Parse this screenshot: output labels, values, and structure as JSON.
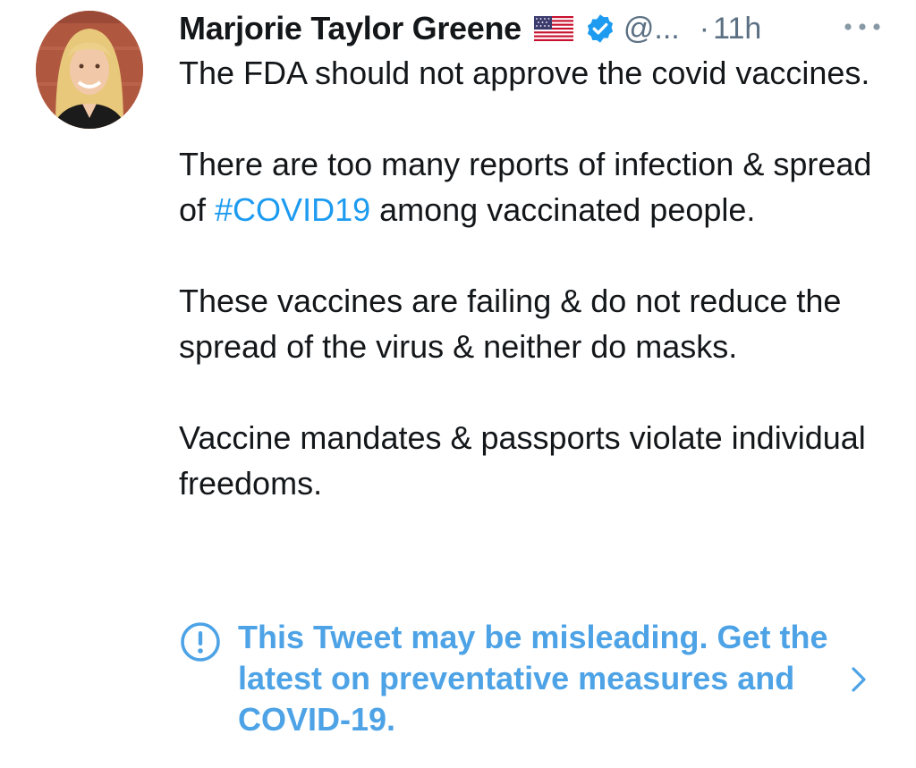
{
  "tweet": {
    "author_name": "Marjorie Taylor Greene",
    "flag": "us-flag-emoji",
    "verified": true,
    "handle": "@...",
    "separator": "·",
    "time": "11h",
    "paragraphs": [
      {
        "text": "The FDA should not approve the covid vaccines."
      },
      {
        "before": "There are too many reports of infection & spread of ",
        "hashtag": "#COVID19",
        "after": " among vaccinated people."
      },
      {
        "text": "These vaccines are failing & do not reduce the spread of the virus & neither do masks."
      },
      {
        "text": "Vaccine mandates & passports violate individual freedoms."
      }
    ]
  },
  "notice": {
    "label": "This Tweet may be misleading. Get the latest on preventative measures and COVID-19.",
    "icon": "exclamation-circle-icon",
    "link_icon": "chevron-right-icon"
  },
  "colors": {
    "text": "#14171a",
    "secondary": "#5b7083",
    "link": "#1d9bf0",
    "notice": "#4da3e6",
    "verified": "#1d9bf0"
  }
}
